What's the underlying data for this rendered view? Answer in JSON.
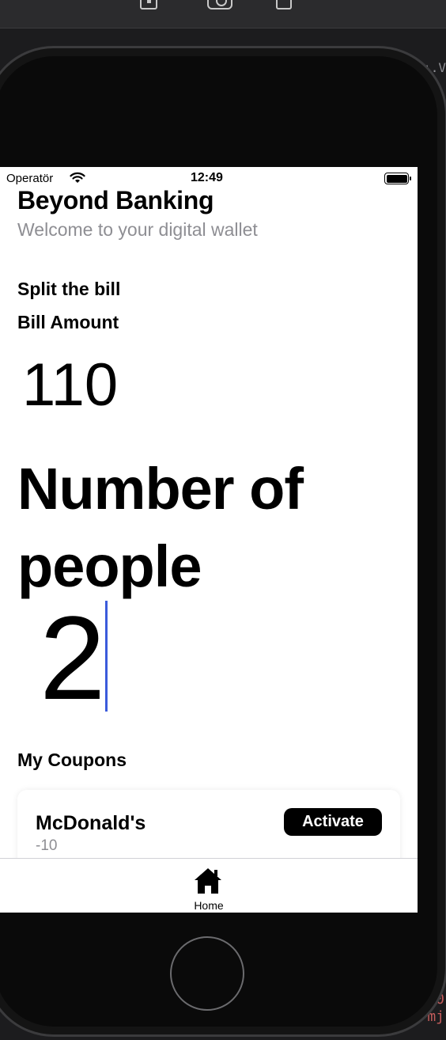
{
  "status_bar": {
    "carrier": "Operatör",
    "time": "12:49"
  },
  "header": {
    "title": "Beyond Banking",
    "subtitle": "Welcome to your digital wallet"
  },
  "split_bill": {
    "title": "Split the bill",
    "bill_label": "Bill Amount",
    "bill_value": "110",
    "people_label": "Number of people",
    "people_value": "2"
  },
  "coupons": {
    "title": "My Coupons",
    "items": [
      {
        "name": "McDonald's",
        "value": "-10",
        "action_label": "Activate"
      }
    ]
  },
  "tab_bar": {
    "items": [
      {
        "label": "Home",
        "icon": "house-icon"
      }
    ]
  },
  "background": {
    "right_text": ":.V",
    "code_line_1": "0",
    "code_line_2": "mj"
  },
  "colors": {
    "caret": "#3b5bdb",
    "button_bg": "#000000",
    "secondary_text": "#8e8e93"
  }
}
